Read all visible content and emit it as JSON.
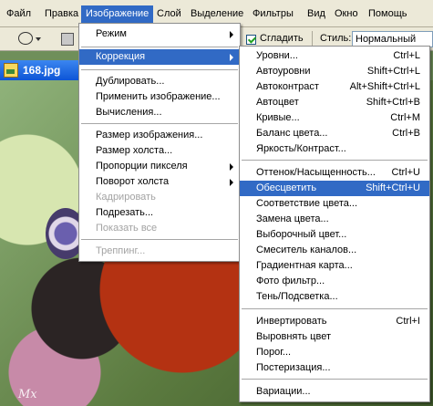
{
  "menubar": {
    "items": [
      "Файл",
      "Правка",
      "Изображение",
      "Слой",
      "Выделение",
      "Фильтры",
      "Вид",
      "Окно",
      "Помощь"
    ],
    "active": "Изображение"
  },
  "options_bar": {
    "smooth_label": "Сгладить",
    "smooth_checked": true,
    "style_label": "Стиль:",
    "style_value": "Нормальный"
  },
  "document": {
    "title": "168.jpg",
    "watermark": "Mx"
  },
  "image_menu": {
    "items": [
      {
        "label": "Режим",
        "submenu": true
      },
      {
        "label": "Коррекция",
        "submenu": true,
        "highlighted": true
      },
      {
        "label": "Дублировать..."
      },
      {
        "label": "Применить изображение..."
      },
      {
        "label": "Вычисления..."
      },
      {
        "label": "Размер изображения..."
      },
      {
        "label": "Размер холста..."
      },
      {
        "label": "Пропорции пикселя",
        "submenu": true
      },
      {
        "label": "Поворот холста",
        "submenu": true
      },
      {
        "label": "Кадрировать",
        "disabled": true
      },
      {
        "label": "Подрезать..."
      },
      {
        "label": "Показать все",
        "disabled": true
      },
      {
        "label": "Треппинг...",
        "disabled": true
      }
    ]
  },
  "adjust_menu": {
    "items": [
      {
        "label": "Уровни...",
        "shortcut": "Ctrl+L"
      },
      {
        "label": "Автоуровни",
        "shortcut": "Shift+Ctrl+L"
      },
      {
        "label": "Автоконтраст",
        "shortcut": "Alt+Shift+Ctrl+L"
      },
      {
        "label": "Автоцвет",
        "shortcut": "Shift+Ctrl+B"
      },
      {
        "label": "Кривые...",
        "shortcut": "Ctrl+M"
      },
      {
        "label": "Баланс цвета...",
        "shortcut": "Ctrl+B"
      },
      {
        "label": "Яркость/Контраст...",
        "shortcut": ""
      },
      {
        "label": "Оттенок/Насыщенность...",
        "shortcut": "Ctrl+U"
      },
      {
        "label": "Обесцветить",
        "shortcut": "Shift+Ctrl+U",
        "highlighted": true
      },
      {
        "label": "Соответствие цвета...",
        "shortcut": ""
      },
      {
        "label": "Замена цвета...",
        "shortcut": ""
      },
      {
        "label": "Выборочный цвет...",
        "shortcut": ""
      },
      {
        "label": "Смеситель каналов...",
        "shortcut": ""
      },
      {
        "label": "Градиентная карта...",
        "shortcut": ""
      },
      {
        "label": "Фото фильтр...",
        "shortcut": ""
      },
      {
        "label": "Тень/Подсветка...",
        "shortcut": ""
      },
      {
        "label": "Инвертировать",
        "shortcut": "Ctrl+I"
      },
      {
        "label": "Выровнять цвет",
        "shortcut": ""
      },
      {
        "label": "Порог...",
        "shortcut": ""
      },
      {
        "label": "Постеризация...",
        "shortcut": ""
      },
      {
        "label": "Вариации...",
        "shortcut": ""
      }
    ]
  },
  "colors": {
    "highlight": "#316ac5",
    "menubar_bg": "#ece9d8",
    "disabled_text": "#a3a3a3"
  }
}
